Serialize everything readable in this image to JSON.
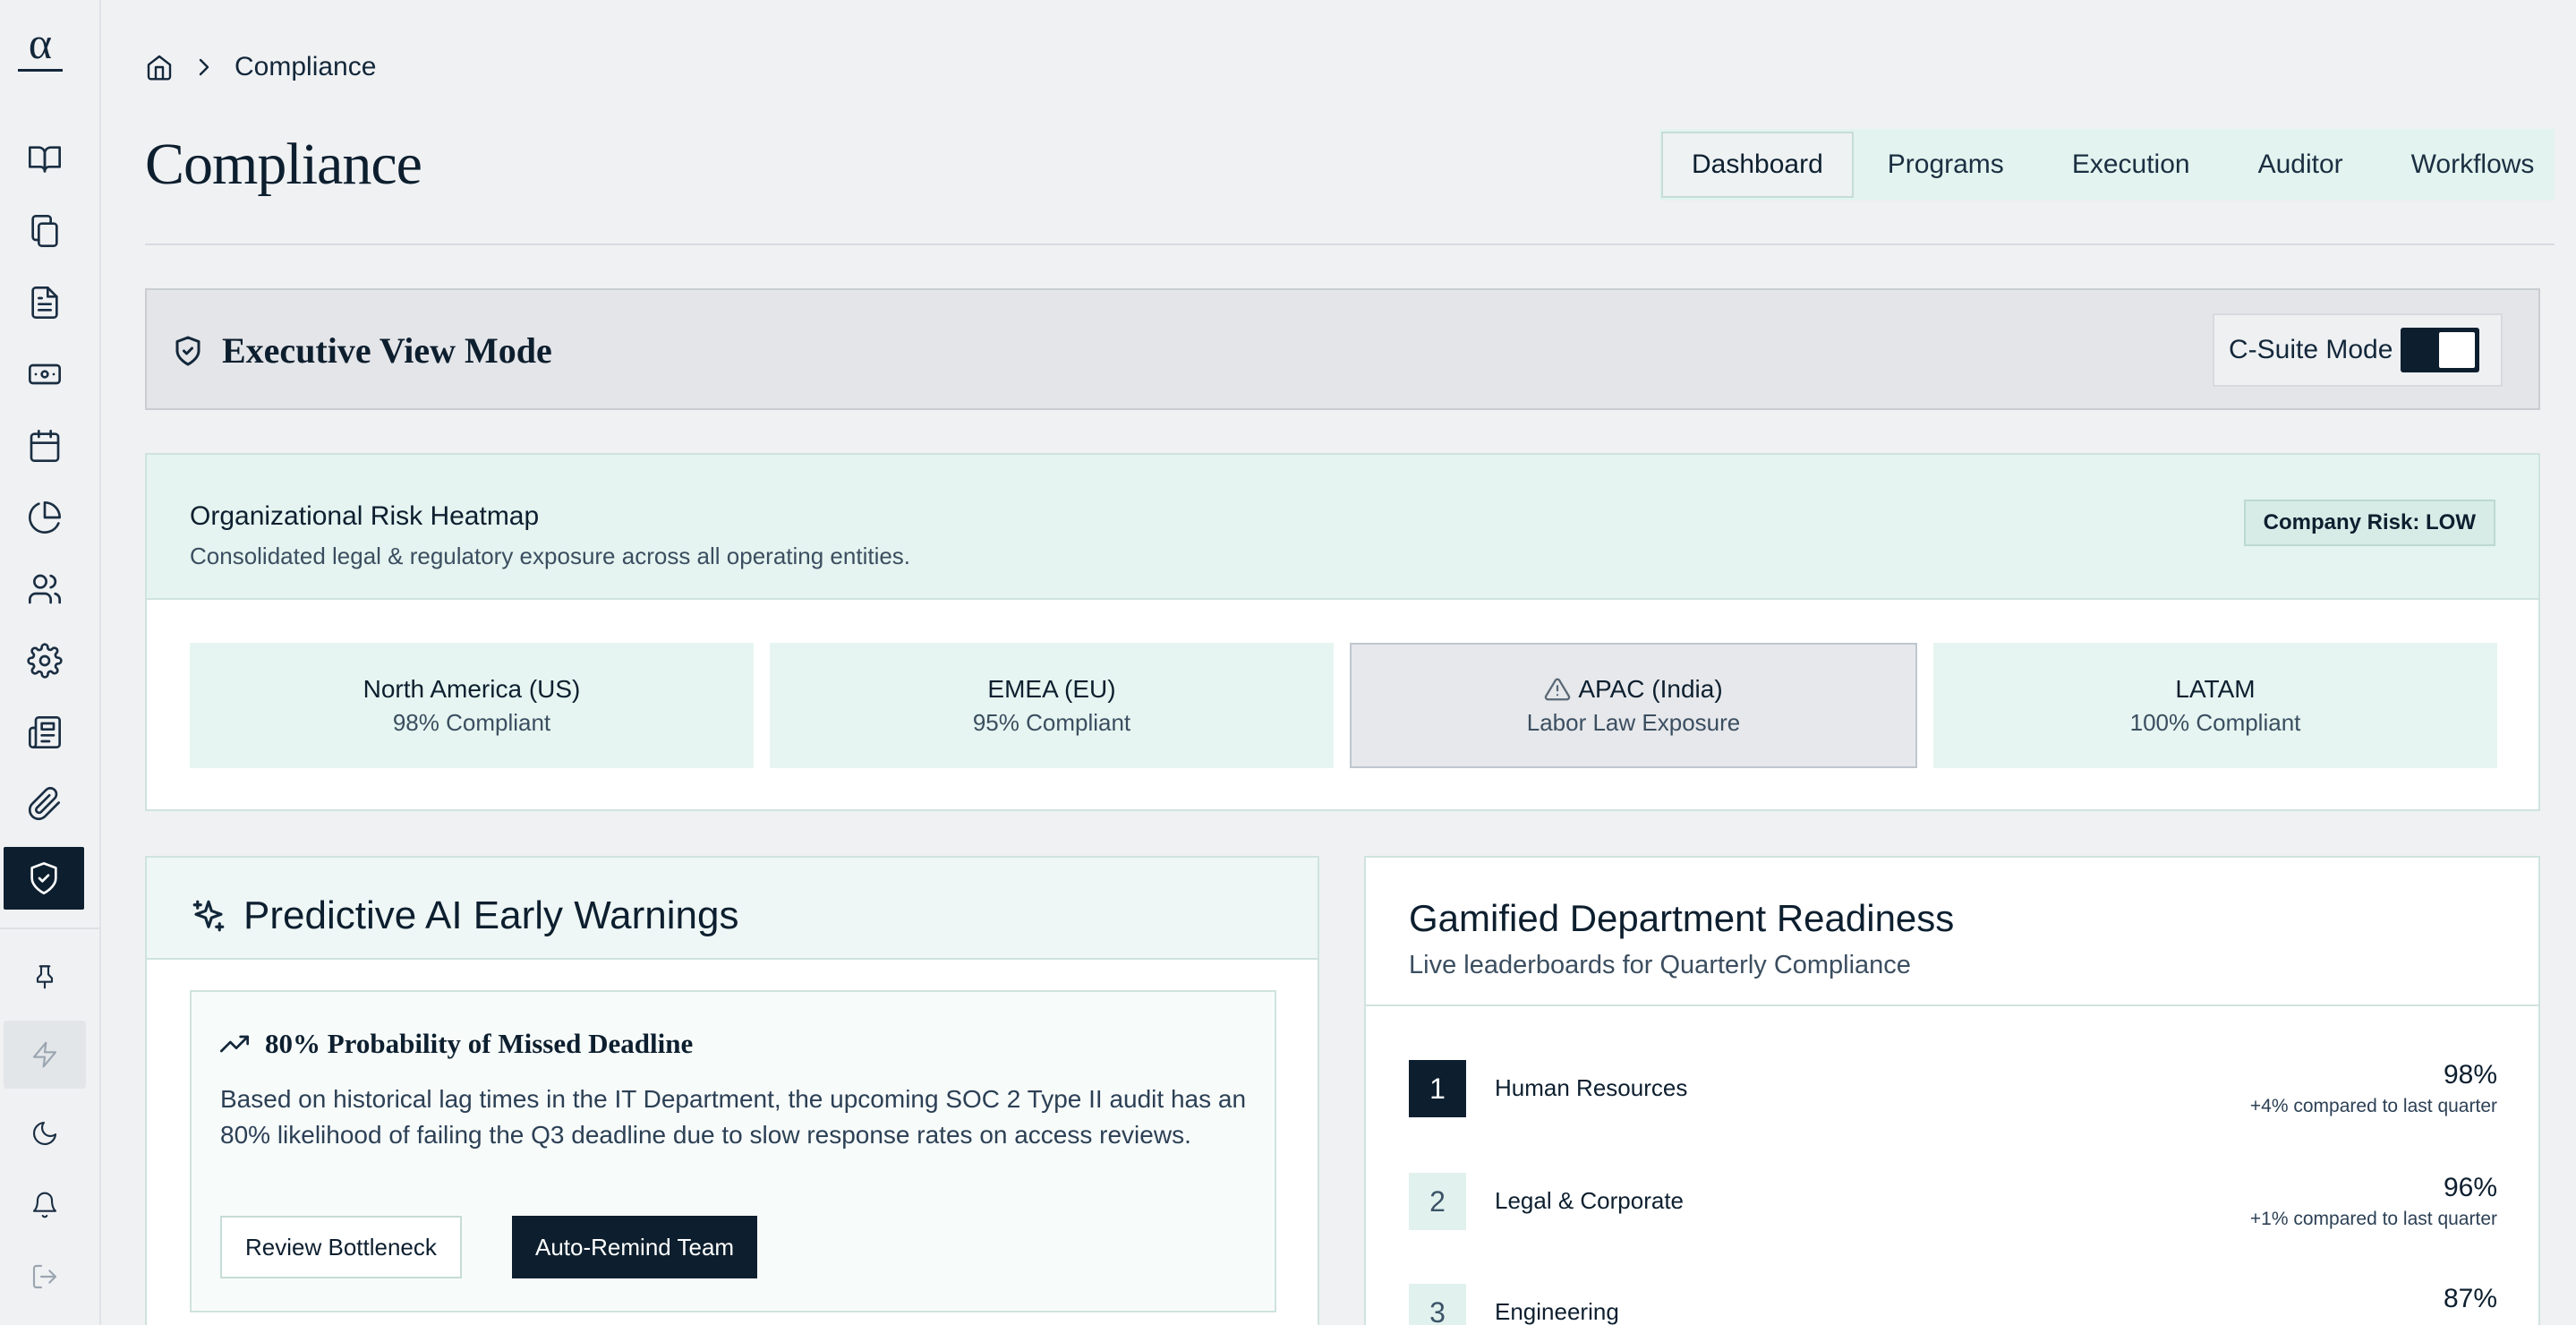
{
  "app": {
    "logo": "α"
  },
  "breadcrumb": {
    "current": "Compliance"
  },
  "page": {
    "title": "Compliance"
  },
  "tabs": [
    {
      "label": "Dashboard",
      "active": true
    },
    {
      "label": "Programs",
      "active": false
    },
    {
      "label": "Execution",
      "active": false
    },
    {
      "label": "Auditor",
      "active": false
    },
    {
      "label": "Workflows",
      "active": false
    }
  ],
  "sidebar": {
    "items": [
      {
        "icon": "book-open-icon"
      },
      {
        "icon": "files-icon"
      },
      {
        "icon": "document-icon"
      },
      {
        "icon": "banknote-icon"
      },
      {
        "icon": "calendar-icon"
      },
      {
        "icon": "pie-chart-icon"
      },
      {
        "icon": "users-icon"
      },
      {
        "icon": "gear-icon"
      },
      {
        "icon": "newspaper-icon"
      },
      {
        "icon": "paperclip-icon"
      },
      {
        "icon": "shield-check-icon",
        "active": true
      }
    ],
    "bottom": [
      {
        "icon": "pin-icon"
      },
      {
        "icon": "bolt-icon"
      },
      {
        "icon": "moon-icon"
      },
      {
        "icon": "bell-icon"
      },
      {
        "icon": "logout-icon"
      }
    ]
  },
  "executive": {
    "title": "Executive View Mode",
    "toggle_label": "C-Suite Mode",
    "toggle_on": true
  },
  "heatmap": {
    "title": "Organizational Risk Heatmap",
    "subtitle": "Consolidated legal & regulatory exposure across all operating entities.",
    "badge": "Company Risk: LOW",
    "regions": [
      {
        "name": "North America (US)",
        "value": "98% Compliant",
        "warning": false
      },
      {
        "name": "EMEA (EU)",
        "value": "95% Compliant",
        "warning": false
      },
      {
        "name": "APAC (India)",
        "value": "Labor Law Exposure",
        "warning": true
      },
      {
        "name": "LATAM",
        "value": "100% Compliant",
        "warning": false
      }
    ]
  },
  "ai": {
    "title": "Predictive AI Early Warnings",
    "warning_title": "80% Probability of Missed Deadline",
    "warning_body": "Based on historical lag times in the IT Department, the upcoming SOC 2 Type II audit has an 80% likelihood of failing the Q3 deadline due to slow response rates on access reviews.",
    "btn_review": "Review Bottleneck",
    "btn_remind": "Auto-Remind Team"
  },
  "readiness": {
    "title": "Gamified Department Readiness",
    "subtitle": "Live leaderboards for Quarterly Compliance",
    "rows": [
      {
        "rank": "1",
        "name": "Human Resources",
        "score": "98%",
        "delta": "+4% compared to last quarter"
      },
      {
        "rank": "2",
        "name": "Legal & Corporate",
        "score": "96%",
        "delta": "+1% compared to last quarter"
      },
      {
        "rank": "3",
        "name": "Engineering",
        "score": "87%",
        "delta": ""
      }
    ]
  }
}
